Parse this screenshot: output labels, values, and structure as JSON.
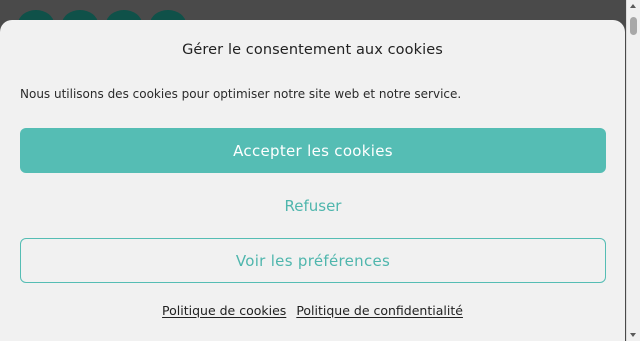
{
  "dialog": {
    "title": "Gérer le consentement aux cookies",
    "message": "Nous utilisons des cookies pour optimiser notre site web et notre service.",
    "accept_label": "Accepter les cookies",
    "refuse_label": "Refuser",
    "preferences_label": "Voir les préférences"
  },
  "footer": {
    "links": [
      {
        "label": "Politique de cookies"
      },
      {
        "label": "Politique de confidentialité"
      }
    ]
  },
  "colors": {
    "accent": "#55bdb4",
    "accent_text": "#4fb6ad",
    "dialog_bg": "#f1f1f1",
    "backdrop": "#4a4a4a",
    "logo": "#0f5149"
  }
}
